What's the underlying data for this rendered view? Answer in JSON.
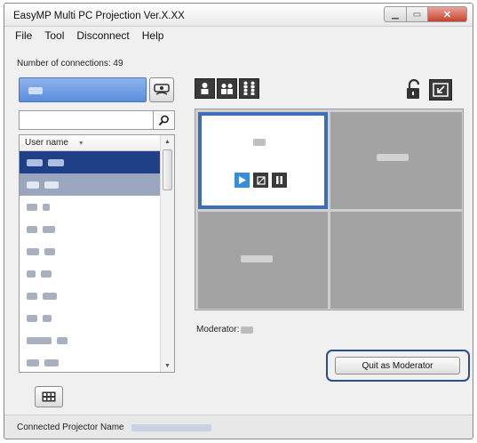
{
  "window": {
    "title": "EasyMP Multi PC Projection Ver.X.XX"
  },
  "menu": [
    {
      "label": "File"
    },
    {
      "label": "Tool"
    },
    {
      "label": "Disconnect"
    },
    {
      "label": "Help"
    }
  ],
  "connections": {
    "label": "Number of connections: 49"
  },
  "search": {
    "value": "",
    "placeholder": ""
  },
  "user_list": {
    "column_header": "User name",
    "row_count": 10,
    "selected_rows": [
      0,
      1
    ]
  },
  "projection": {
    "layout": "2x2",
    "active_panel": 0
  },
  "moderator": {
    "label": "Moderator:"
  },
  "quit_button": {
    "label": "Quit as Moderator"
  },
  "status": {
    "label": "Connected Projector Name"
  },
  "colors": {
    "selection": "#1f3f86",
    "accent": "#3e6fb6",
    "play": "#3a8ddc"
  }
}
